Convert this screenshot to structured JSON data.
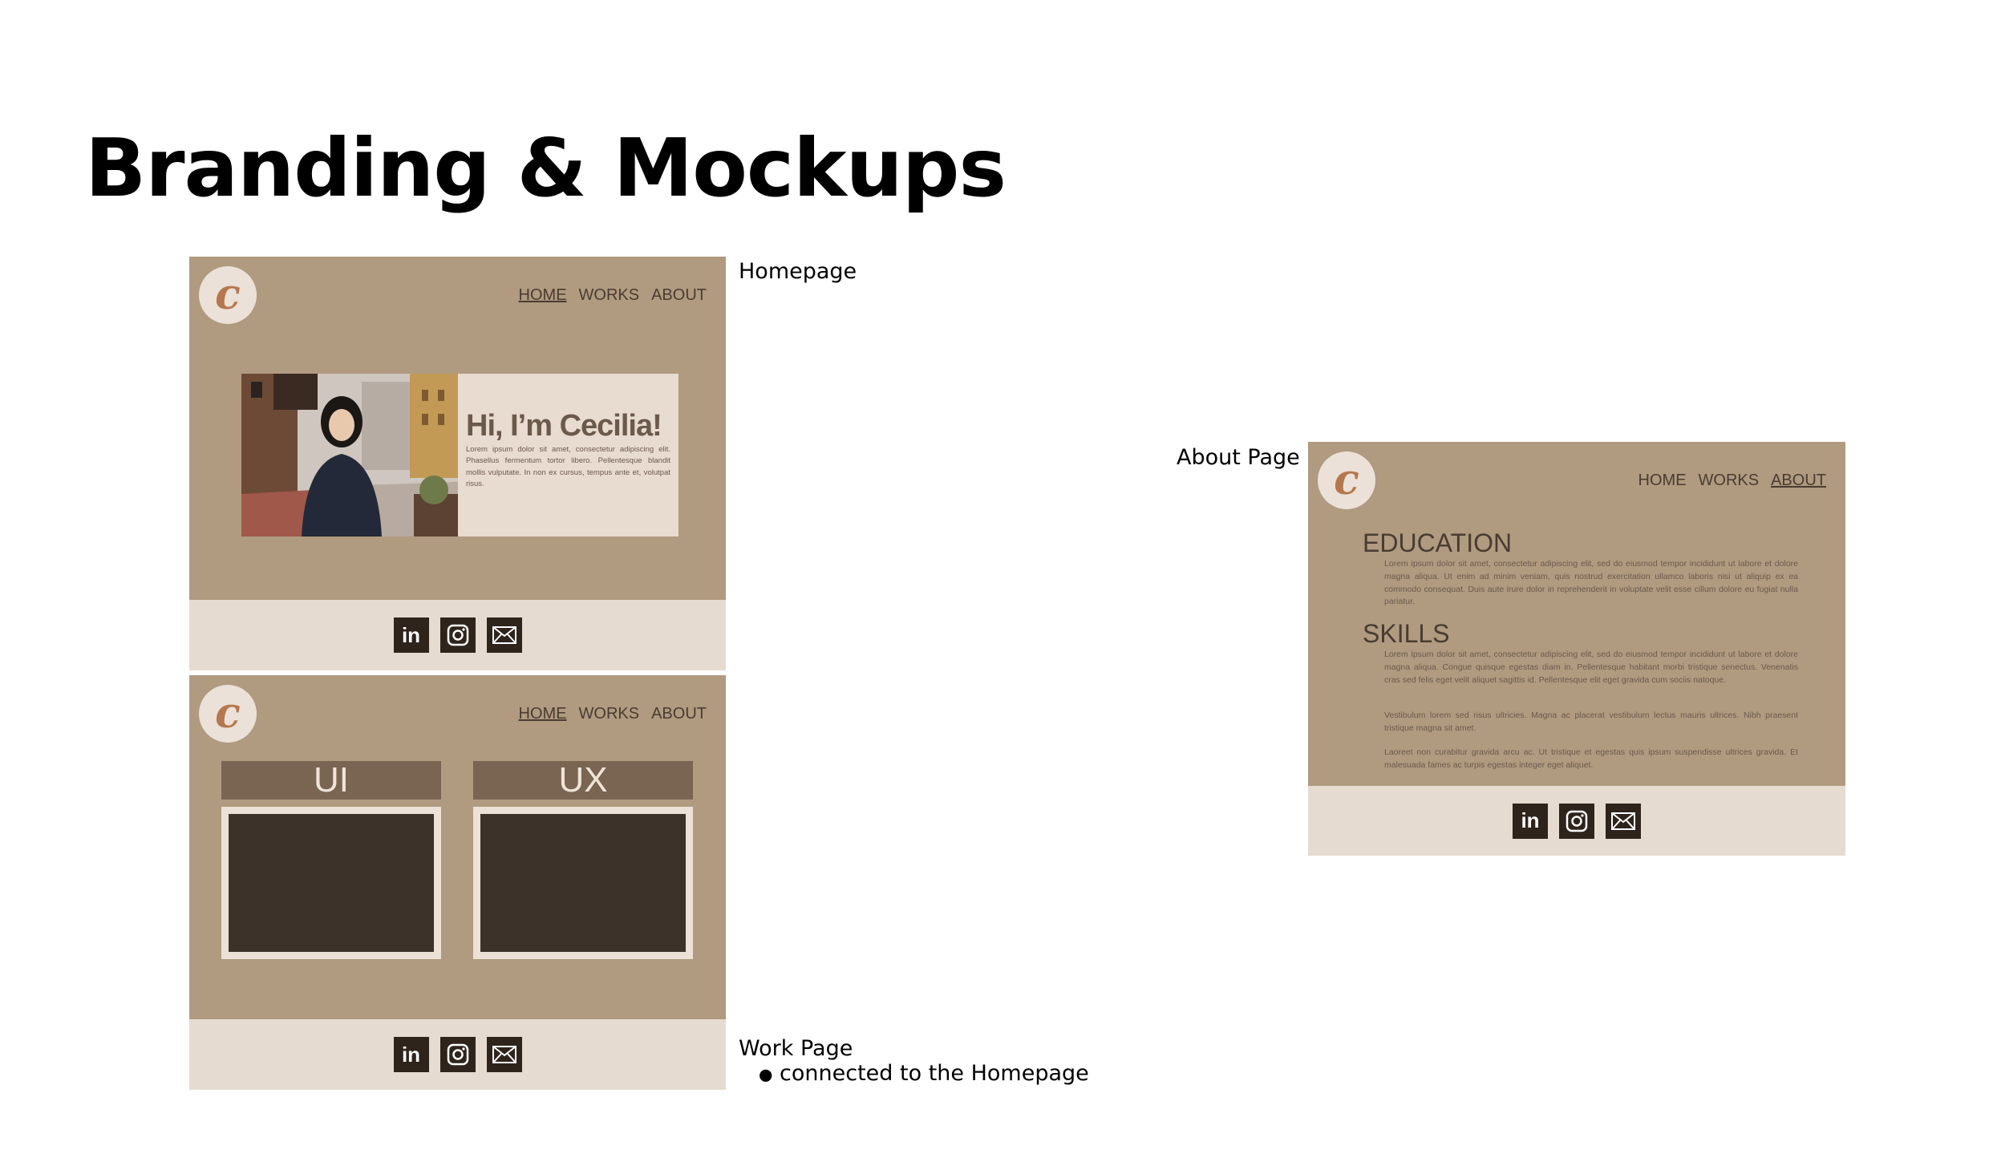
{
  "page_title": "Branding & Mockups",
  "captions": {
    "homepage": "Homepage",
    "about": "About Page",
    "work": "Work Page",
    "work_bullet": "connected to the Homepage"
  },
  "site": {
    "logo_letter": "c",
    "nav": [
      "HOME",
      "WORKS",
      "ABOUT"
    ],
    "social": [
      "in",
      "◎",
      "✉"
    ]
  },
  "homepage": {
    "hero_heading": "Hi, I’m Cecilia!",
    "hero_text": "Lorem ipsum dolor sit amet, consectetur adipiscing elit. Phasellus fermentum tortor libero. Pellentesque blandit mollis vulputate. In non ex cursus, tempus ante et, volutpat risus.",
    "active_nav": "HOME"
  },
  "work": {
    "tiles": [
      "UI",
      "UX"
    ],
    "active_nav": "HOME"
  },
  "about": {
    "active_nav": "ABOUT",
    "education_heading": "EDUCATION",
    "education_text": "Lorem ipsum dolor sit amet, consectetur adipiscing elit, sed do eiusmod tempor incididunt ut labore et dolore magna aliqua. Ut enim ad minim veniam, quis nostrud exercitation ullamco laboris nisi ut aliquip ex ea commodo consequat. Duis aute irure dolor in reprehenderit in voluptate velit esse cillum dolore eu fugiat nulla pariatur.",
    "skills_heading": "SKILLS",
    "skills_text_1": "Lorem ipsum dolor sit amet, consectetur adipiscing elit, sed do eiusmod tempor incididunt ut labore et dolore magna aliqua. Congue quisque egestas diam in. Pellentesque habitant morbi tristique senectus. Venenatis cras sed felis eget velit aliquet sagittis id. Pellentesque elit eget gravida cum sociis natoque.",
    "skills_text_2": "Vestibulum lorem sed risus ultricies. Magna ac placerat vestibulum lectus mauris ultrices. Nibh praesent tristique magna sit amet.",
    "skills_text_3": "Laoreet non curabitur gravida arcu ac. Ut tristique et egestas quis ipsum suspendisse ultrices gravida. Et malesuada fames ac turpis egestas integer eget aliquet."
  },
  "colors": {
    "mock_bg": "#b09a80",
    "footer_bg": "#e6dbd0",
    "dark": "#2f241c",
    "tile_head": "#7a6452",
    "tile_body": "#3c3229"
  }
}
